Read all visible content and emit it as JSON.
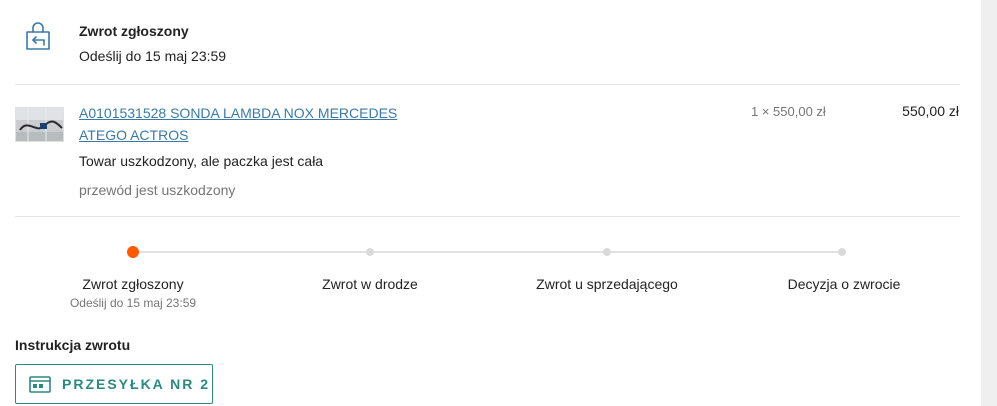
{
  "status": {
    "title": "Zwrot zgłoszony",
    "subtitle": "Odeślij do 15 maj 23:59",
    "icon": "return-bag-icon",
    "accent": "#3a7aa8"
  },
  "item": {
    "thumbnail": "product-thumbnail",
    "title": "A0101531528 SONDA LAMBDA NOX MERCEDES ATEGO ACTROS",
    "reason": "Towar uszkodzony, ale paczka jest cała",
    "comment": "przewód jest uszkodzony",
    "quantity_price": "1 × 550,00 zł",
    "total": "550,00 zł",
    "link_color": "#3a7aa8"
  },
  "progress": {
    "active_color": "#ff5a00",
    "steps": [
      {
        "label": "Zwrot zgłoszony",
        "sub": "Odeślij do 15 maj 23:59",
        "active": true
      },
      {
        "label": "Zwrot w drodze",
        "sub": "",
        "active": false
      },
      {
        "label": "Zwrot u sprzedającego",
        "sub": "",
        "active": false
      },
      {
        "label": "Decyzja o zwrocie",
        "sub": "",
        "active": false
      }
    ]
  },
  "instructions": {
    "title": "Instrukcja zwrotu",
    "button_label": "PRZESYŁKA NR 2",
    "button_icon": "parcel-icon",
    "button_color": "#2b8a7e"
  }
}
